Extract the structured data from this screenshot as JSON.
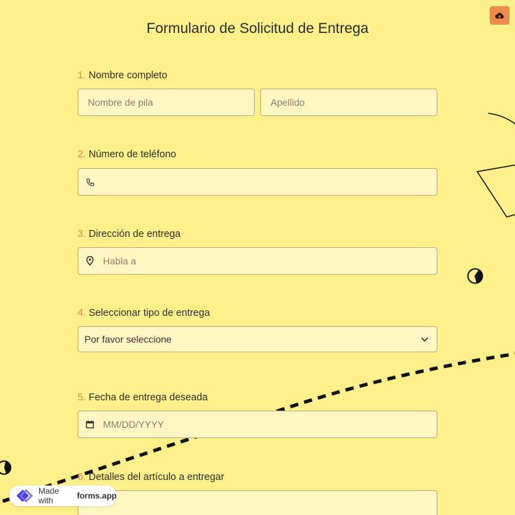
{
  "form": {
    "title": "Formulario de Solicitud de Entrega",
    "save_icon": "cloud-download-icon",
    "accent_color": "#f08a4b",
    "background_color": "#fdf08a",
    "questions": [
      {
        "number": "1.",
        "label": "Nombre completo",
        "first_name_placeholder": "Nombre de pila",
        "last_name_placeholder": "Apellido"
      },
      {
        "number": "2.",
        "label": "Número de teléfono",
        "placeholder": "",
        "icon": "phone-icon"
      },
      {
        "number": "3.",
        "label": "Dirección de entrega",
        "placeholder": "Habla a",
        "icon": "map-pin-icon"
      },
      {
        "number": "4.",
        "label": "Seleccionar tipo de entrega",
        "selected": "Por favor seleccione",
        "icon": "chevron-down-icon"
      },
      {
        "number": "5.",
        "label": "Fecha de entrega deseada",
        "placeholder": "MM/DD/YYYY",
        "icon": "calendar-icon"
      },
      {
        "number": "6.",
        "label": "Detalles del artículo a entregar"
      }
    ]
  },
  "badge": {
    "prefix": "Made with",
    "brand": "forms.app"
  }
}
